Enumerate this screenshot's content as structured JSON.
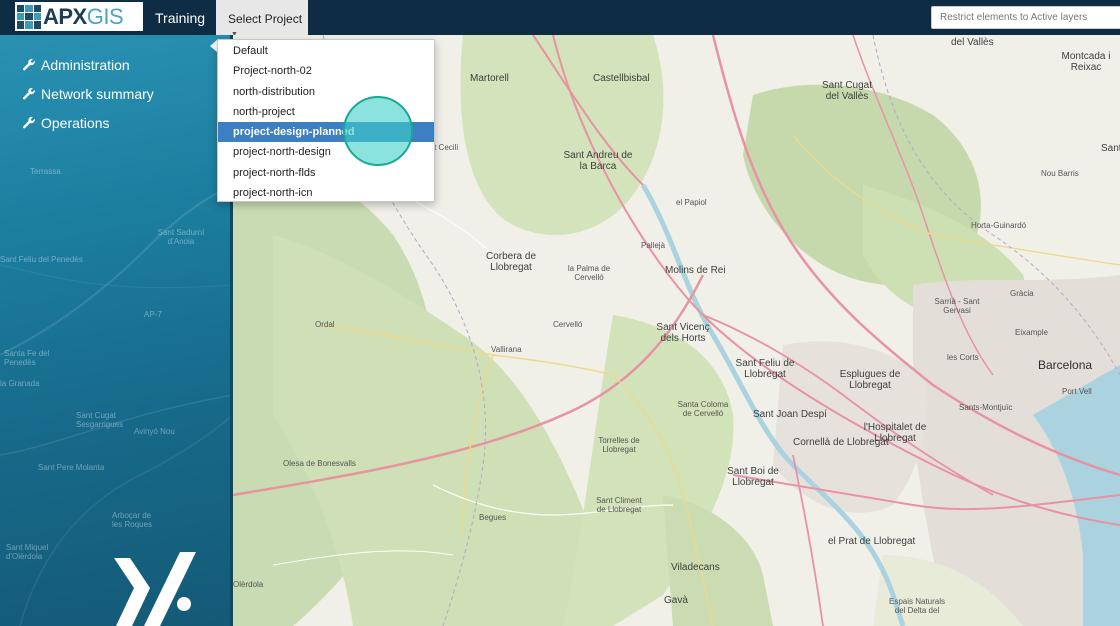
{
  "header": {
    "logo": {
      "part1": "APX",
      "part2": "GIS"
    },
    "app_title": "Training",
    "project_select_label": "Select Project",
    "search_placeholder": "Restrict elements to Active layers"
  },
  "sidebar": {
    "items": [
      {
        "label": "Administration",
        "icon": "wrench-icon"
      },
      {
        "label": "Network summary",
        "icon": "wrench-icon"
      },
      {
        "label": "Operations",
        "icon": "wrench-icon"
      }
    ],
    "map_labels": [
      "Terrassa",
      "Sant Sadurní d'Anoia",
      "Sant Feliu del Penedès",
      "Santa Fe del Penedès",
      "la Granada",
      "Sant Cugat Sesgarrigues",
      "Avinyó Nou",
      "Sant Pere Molanta",
      "Arboçar de les Roques",
      "Sant Miquel d'Olèrdola",
      "AP-7"
    ]
  },
  "project_dropdown": {
    "options": [
      "Default",
      "Project-north-02",
      "north-distribution",
      "north-project",
      "project-design-planned",
      "project-north-design",
      "project-north-flds",
      "project-north-icn"
    ],
    "highlighted_index": 4
  },
  "map": {
    "labels": [
      {
        "text": "Martorell"
      },
      {
        "text": "Castellbisbal"
      },
      {
        "text": "del Vallès"
      },
      {
        "text": "Montcada i Reixac"
      },
      {
        "text": "Sant Cugat del Vallès"
      },
      {
        "text": "Sant Andreu de la Barca"
      },
      {
        "text": "el Papiol"
      },
      {
        "text": "Nou Barris"
      },
      {
        "text": "Horta-Guinardó"
      },
      {
        "text": "Pallejà"
      },
      {
        "text": "Corbera de Llobregat"
      },
      {
        "text": "la Palma de Cervelló"
      },
      {
        "text": "Molins de Rei"
      },
      {
        "text": "Sarrià - Sant Gervasi"
      },
      {
        "text": "Gràcia"
      },
      {
        "text": "Eixample"
      },
      {
        "text": "Ordal"
      },
      {
        "text": "Cervelló"
      },
      {
        "text": "Sant Vicenç dels Horts"
      },
      {
        "text": "Vallirana"
      },
      {
        "text": "Sant Feliu de Llobregat"
      },
      {
        "text": "les Corts"
      },
      {
        "text": "Barcelona"
      },
      {
        "text": "Esplugues de Llobregat"
      },
      {
        "text": "Port Vell"
      },
      {
        "text": "Santa Coloma de Cervelló"
      },
      {
        "text": "Sant Joan Despí"
      },
      {
        "text": "Sants-Montjuïc"
      },
      {
        "text": "Torrelles de Llobregat"
      },
      {
        "text": "l'Hospitalet de Llobregat"
      },
      {
        "text": "Cornellà de Llobregat"
      },
      {
        "text": "Olesa de Bonesvalls"
      },
      {
        "text": "Sant Boi de Llobregat"
      },
      {
        "text": "Sant Climent de Llobregat"
      },
      {
        "text": "Begues"
      },
      {
        "text": "el Prat de Llobregat"
      },
      {
        "text": "Viladecans"
      },
      {
        "text": "Gavà"
      },
      {
        "text": "Olèrdola"
      },
      {
        "text": "Espais Naturals del Delta del"
      },
      {
        "text": "Sant"
      },
      {
        "text": "Sant Cecili"
      }
    ]
  }
}
